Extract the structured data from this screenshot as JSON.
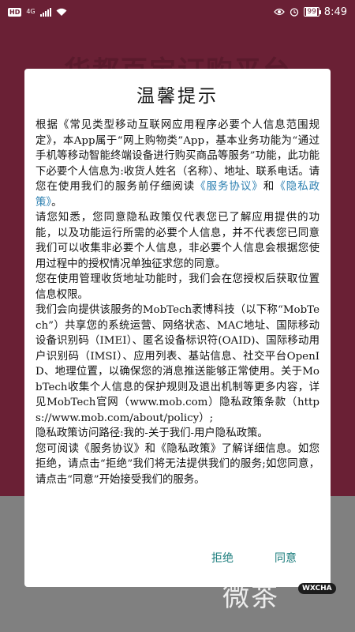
{
  "background": {
    "title": "华都百宝订购平台"
  },
  "statusbar": {
    "hd": "HD",
    "network": "4G",
    "battery": "99",
    "time": "8:49"
  },
  "dialog": {
    "title": "温馨提示",
    "p1_part1": "根据《常见类型移动互联网应用程序必要个人信息范围规定》，本App属于“网上购物类”App，基本业务功能为“通过手机等移动智能终端设备进行购买商品等服务”功能，此功能下必要个人信息为:收货人姓名（名称）、地址、联系电话。请您在使用我们的服务前仔细阅读",
    "link_agreement": "《服务协议》",
    "p1_and": "和",
    "link_privacy": "《隐私政策》",
    "p1_end": "。",
    "p2": "请您知悉，您同意隐私政策仅代表您已了解应用提供的功能，以及功能运行所需的必要个人信息，并不代表您已同意我们可以收集非必要个人信息，非必要个人信息会根据您使用过程中的授权情况单独征求您的同意。",
    "p3": "您在使用管理收货地址功能时，我们会在您授权后获取位置信息权限。",
    "p4": "我们会向提供该服务的MobTech袤博科技（以下称“MobTech”）共享您的系统运营、网络状态、MAC地址、国际移动设备识别码（IMEI）、匿名设备标识符(OAID)、国际移动用户识别码（IMSI）、应用列表、基站信息、社交平台OpenID、地理位置，以确保您的消息推送能够正常使用。关于MobTech收集个人信息的保护规则及退出机制等更多内容，详见MobTech官网（www.mob.com）隐私政策条款（https://www.mob.com/about/policy）;",
    "p5": "隐私政策访问路径:我的-关于我们-用户隐私政策。",
    "p6": "您可阅读《服务协议》和《隐私政策》了解详细信息。如您拒绝，请点击“拒绝”我们将无法提供我们的服务;如您同意，请点击“同意”开始接受我们的服务。",
    "reject_label": "拒绝",
    "agree_label": "同意"
  },
  "watermark": {
    "text": "微茶",
    "badge": "WXCHA"
  },
  "colors": {
    "background_top": "#6a2035",
    "background_bottom": "#808080",
    "dialog": "#ffffff",
    "link": "#2b7fb0",
    "button": "#1a7c7c"
  }
}
